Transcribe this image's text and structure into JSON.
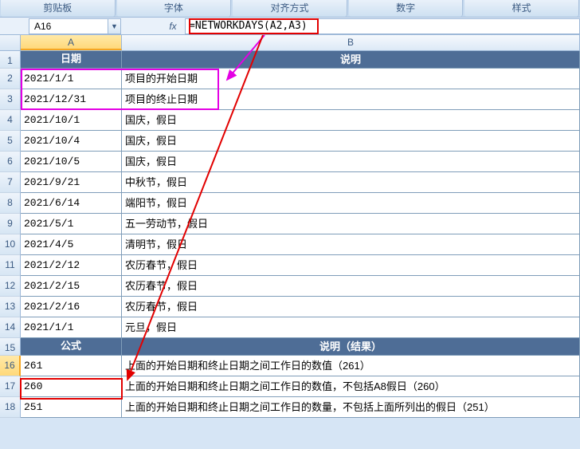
{
  "ribbon": {
    "tabs": [
      "剪贴板",
      "字体",
      "对齐方式",
      "数字",
      "样式"
    ]
  },
  "namebox": {
    "value": "A16"
  },
  "fx_label": "fx",
  "formula": "=NETWORKDAYS(A2,A3)",
  "columns": {
    "A": "A",
    "B": "B"
  },
  "rows": [
    {
      "n": "1",
      "A": "日期",
      "B": "说明",
      "hdr": true
    },
    {
      "n": "2",
      "A": "2021/1/1",
      "B": "项目的开始日期"
    },
    {
      "n": "3",
      "A": "2021/12/31",
      "B": "项目的终止日期"
    },
    {
      "n": "4",
      "A": "2021/10/1",
      "B": "国庆，假日"
    },
    {
      "n": "5",
      "A": "2021/10/4",
      "B": "国庆，假日"
    },
    {
      "n": "6",
      "A": "2021/10/5",
      "B": "国庆，假日"
    },
    {
      "n": "7",
      "A": "2021/9/21",
      "B": "中秋节，假日"
    },
    {
      "n": "8",
      "A": "2021/6/14",
      "B": "端阳节，假日"
    },
    {
      "n": "9",
      "A": "2021/5/1",
      "B": "五一劳动节，假日"
    },
    {
      "n": "10",
      "A": "2021/4/5",
      "B": "清明节，假日"
    },
    {
      "n": "11",
      "A": "2021/2/12",
      "B": "农历春节，假日"
    },
    {
      "n": "12",
      "A": "2021/2/15",
      "B": "农历春节，假日"
    },
    {
      "n": "13",
      "A": "2021/2/16",
      "B": "农历春节，假日"
    },
    {
      "n": "14",
      "A": "2021/1/1",
      "B": "元旦，假日"
    },
    {
      "n": "15",
      "A": "公式",
      "B": "说明（结果）",
      "hdr": true
    },
    {
      "n": "16",
      "A": "261",
      "B": "上面的开始日期和终止日期之间工作日的数值（261）",
      "sel": true
    },
    {
      "n": "17",
      "A": "260",
      "B": "上面的开始日期和终止日期之间工作日的数值，不包括A8假日（260）"
    },
    {
      "n": "18",
      "A": "251",
      "B": "上面的开始日期和终止日期之间工作日的数量，不包括上面所列出的假日（251）"
    }
  ]
}
